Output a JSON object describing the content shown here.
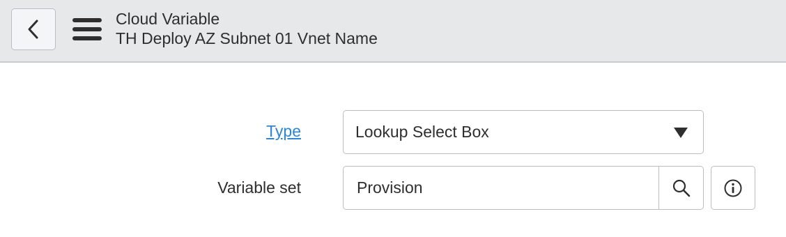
{
  "header": {
    "title": "Cloud Variable",
    "subtitle": "TH Deploy AZ Subnet 01 Vnet Name",
    "back_icon": "chevron-left-icon",
    "menu_icon": "hamburger-menu-icon"
  },
  "form": {
    "type": {
      "label": "Type",
      "value": "Lookup Select Box",
      "arrow_icon": "caret-down-icon"
    },
    "variable_set": {
      "label": "Variable set",
      "value": "Provision",
      "search_icon": "search-icon",
      "info_icon": "info-icon"
    }
  },
  "colors": {
    "header_bg": "#e6e8ea",
    "link": "#2d86d1",
    "border": "#b9bdc2",
    "text": "#2e2e2e"
  }
}
